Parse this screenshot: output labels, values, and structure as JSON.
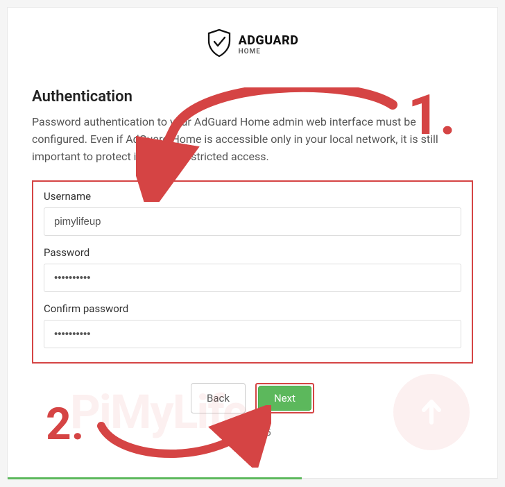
{
  "logo": {
    "title": "ADGUARD",
    "subtitle": "HOME"
  },
  "heading": "Authentication",
  "description": "Password authentication to your AdGuard Home admin web interface must be configured. Even if AdGuard Home is accessible only in your local network, it is still important to protect it from unrestricted access.",
  "form": {
    "username_label": "Username",
    "username_value": "pimylifeup",
    "password_label": "Password",
    "password_value": "••••••••••",
    "confirm_label": "Confirm password",
    "confirm_value": "••••••••••"
  },
  "buttons": {
    "back": "Back",
    "next": "Next"
  },
  "step": "Step 3/5",
  "annotations": {
    "one": "1.",
    "two": "2."
  },
  "watermark": "PiMyLife"
}
